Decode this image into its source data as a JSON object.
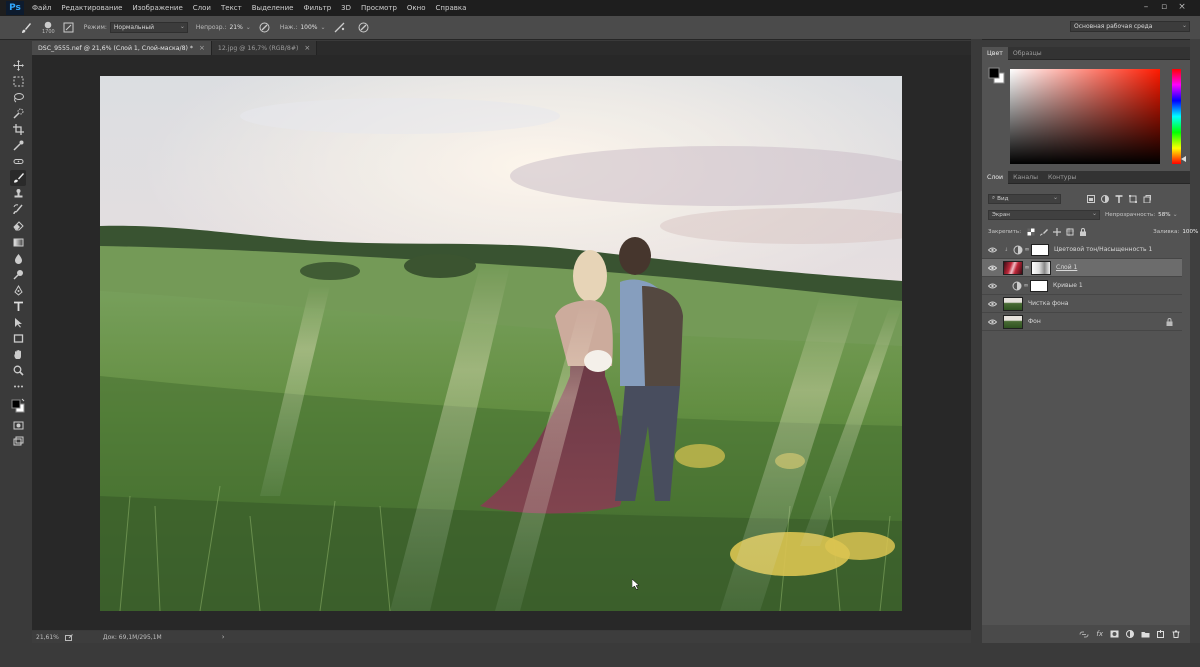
{
  "app": {
    "logo": "Ps"
  },
  "menu": [
    "Файл",
    "Редактирование",
    "Изображение",
    "Слои",
    "Текст",
    "Выделение",
    "Фильтр",
    "3D",
    "Просмотр",
    "Окно",
    "Справка"
  ],
  "options": {
    "brush_size": "1700",
    "mode_label": "Режим:",
    "mode_value": "Нормальный",
    "opacity_label": "Непрозр.:",
    "opacity_value": "21%",
    "pressure_label": "Наж.:",
    "pressure_value": "100%",
    "workspace": "Основная рабочая среда"
  },
  "tabs": [
    {
      "label": "DSC_9555.nef @ 21,6% (Слой 1, Слой-маска/8) *",
      "close": "×"
    },
    {
      "label": "12.jpg @ 16,7% (RGB/8#)",
      "close": "×"
    }
  ],
  "status": {
    "zoom": "21,61%",
    "doc": "Док: 69,1M/295,1M",
    "arrow": "›"
  },
  "color_panel": {
    "tabs": [
      "Цвет",
      "Образцы"
    ],
    "base_hue": "#ff1a00"
  },
  "layers_panel": {
    "tabs": [
      "Слои",
      "Каналы",
      "Контуры"
    ],
    "filter_label": "Вид",
    "blend_mode": "Экран",
    "opacity_label": "Непрозрачность:",
    "opacity_value": "58%",
    "lock_label": "Закрепить:",
    "fill_label": "Заливка:",
    "fill_value": "100%",
    "layers": [
      {
        "name": "Цветовой тон/Насыщенность 1",
        "kind": "adjustment"
      },
      {
        "name": "Слой 1",
        "kind": "paint",
        "selected": true
      },
      {
        "name": "Кривые 1",
        "kind": "curves"
      },
      {
        "name": "Чистка фона",
        "kind": "photo"
      },
      {
        "name": "Фон",
        "kind": "photo",
        "locked": true
      }
    ]
  },
  "colors": {
    "accent": "#31a8ff",
    "panel": "#535353",
    "chrome": "#1e1e1e"
  }
}
